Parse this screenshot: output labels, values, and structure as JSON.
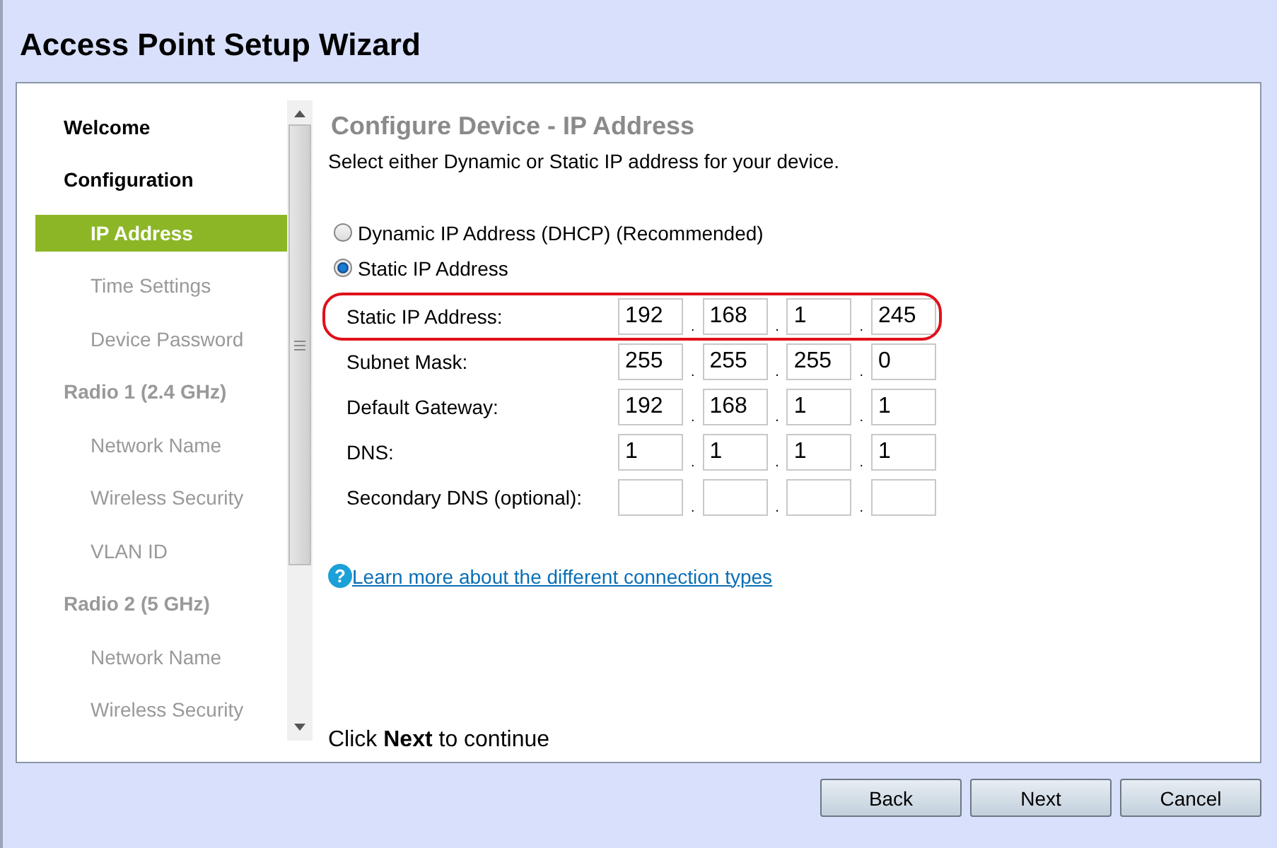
{
  "window": {
    "title": "Access Point Setup Wizard"
  },
  "sidebar": {
    "items": [
      {
        "label": "Welcome",
        "kind": "heading",
        "selected": false,
        "disabled": false
      },
      {
        "label": "Configuration",
        "kind": "heading",
        "selected": false,
        "disabled": false
      },
      {
        "label": "IP Address",
        "kind": "step",
        "selected": true,
        "disabled": false
      },
      {
        "label": "Time Settings",
        "kind": "step",
        "selected": false,
        "disabled": true
      },
      {
        "label": "Device Password",
        "kind": "step",
        "selected": false,
        "disabled": true
      },
      {
        "label": "Radio 1 (2.4 GHz)",
        "kind": "heading",
        "selected": false,
        "disabled": true
      },
      {
        "label": "Network Name",
        "kind": "step",
        "selected": false,
        "disabled": true
      },
      {
        "label": "Wireless Security",
        "kind": "step",
        "selected": false,
        "disabled": true
      },
      {
        "label": "VLAN ID",
        "kind": "step",
        "selected": false,
        "disabled": true
      },
      {
        "label": "Radio 2 (5 GHz)",
        "kind": "heading",
        "selected": false,
        "disabled": true
      },
      {
        "label": "Network Name",
        "kind": "step",
        "selected": false,
        "disabled": true
      },
      {
        "label": "Wireless Security",
        "kind": "step",
        "selected": false,
        "disabled": true
      }
    ]
  },
  "content": {
    "title": "Configure Device - IP Address",
    "subtitle": "Select either Dynamic or Static IP address for your device.",
    "options": [
      {
        "label": "Dynamic IP Address (DHCP) (Recommended)",
        "selected": false
      },
      {
        "label": "Static IP Address",
        "selected": true
      }
    ],
    "fields": [
      {
        "label": "Static IP Address:",
        "highlighted": true,
        "octets": [
          {
            "value": "192"
          },
          {
            "value": "168"
          },
          {
            "value": "1"
          },
          {
            "value": "245"
          }
        ]
      },
      {
        "label": "Subnet Mask:",
        "highlighted": false,
        "octets": [
          {
            "value": "255"
          },
          {
            "value": "255"
          },
          {
            "value": "255"
          },
          {
            "value": "0"
          }
        ]
      },
      {
        "label": "Default Gateway:",
        "highlighted": false,
        "octets": [
          {
            "value": "192"
          },
          {
            "value": "168"
          },
          {
            "value": "1"
          },
          {
            "value": "1"
          }
        ]
      },
      {
        "label": "DNS:",
        "highlighted": false,
        "octets": [
          {
            "value": "1"
          },
          {
            "value": "1"
          },
          {
            "value": "1"
          },
          {
            "value": "1"
          }
        ]
      },
      {
        "label": "Secondary DNS (optional):",
        "highlighted": false,
        "octets": [
          {
            "kind": "blank"
          },
          {
            "kind": "blank"
          },
          {
            "kind": "blank"
          },
          {
            "kind": "blank"
          }
        ]
      }
    ],
    "separator": ".",
    "help_icon": "?",
    "help_link": "Learn more about the different connection types",
    "footer_note": "Click **Next** to continue"
  },
  "buttons": [
    "Back",
    "Next",
    "Cancel"
  ]
}
